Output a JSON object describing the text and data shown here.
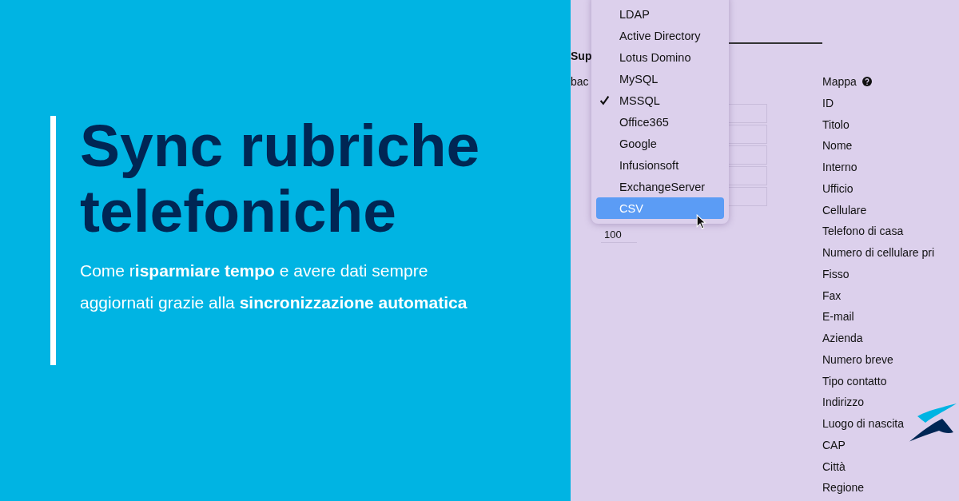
{
  "headline": "Sync rubriche telefoniche",
  "subtitle": "Come r**isparmiare tempo** e avere dati sempre aggiornati grazie alla **sincronizzazione automatica**",
  "screenshot": {
    "tab_label": "Sup",
    "field_label": "bac",
    "limit_value": "100",
    "mapping_header": "Mappa",
    "mapping_fields": [
      "ID",
      "Titolo",
      "Nome",
      "Interno",
      "Ufficio",
      "Cellulare",
      "Telefono di casa",
      "Numero di cellulare pri",
      "Fisso",
      "Fax",
      "E-mail",
      "Azienda",
      "Numero breve",
      "Tipo contatto",
      "Indirizzo",
      "Luogo di nascita",
      "CAP",
      "Città",
      "Regione"
    ],
    "source_menu": [
      {
        "label": "LDAP",
        "checked": false,
        "selected": false
      },
      {
        "label": "Active Directory",
        "checked": false,
        "selected": false
      },
      {
        "label": "Lotus Domino",
        "checked": false,
        "selected": false
      },
      {
        "label": "MySQL",
        "checked": false,
        "selected": false
      },
      {
        "label": "MSSQL",
        "checked": true,
        "selected": false
      },
      {
        "label": "Office365",
        "checked": false,
        "selected": false
      },
      {
        "label": "Google",
        "checked": false,
        "selected": false
      },
      {
        "label": "Infusionsoft",
        "checked": false,
        "selected": false
      },
      {
        "label": "ExchangeServer",
        "checked": false,
        "selected": false
      },
      {
        "label": "CSV",
        "checked": false,
        "selected": true
      }
    ]
  }
}
